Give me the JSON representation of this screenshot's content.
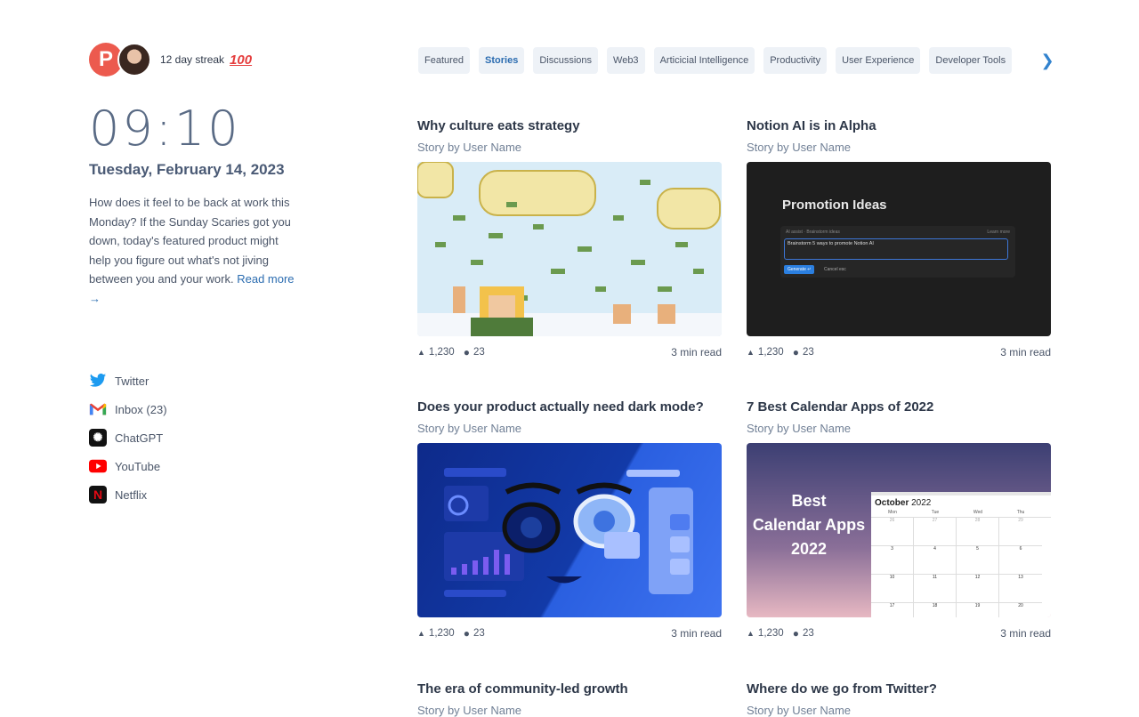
{
  "header": {
    "avatar_letter": "P",
    "streak": "12 day streak",
    "streak_emoji": "100"
  },
  "clock": {
    "time": "09:10",
    "date": "Tuesday, February 14, 2023"
  },
  "blurb": {
    "text": "How does it feel to be back at work this Monday? If the Sunday Scaries got you down, today's featured product might help you figure out what's not jiving between you and your work. ",
    "link": "Read more →"
  },
  "quick_links": [
    {
      "label": "Twitter",
      "icon": "twitter-icon"
    },
    {
      "label": "Inbox (23)",
      "icon": "gmail-icon"
    },
    {
      "label": "ChatGPT",
      "icon": "chatgpt-icon"
    },
    {
      "label": "YouTube",
      "icon": "youtube-icon"
    },
    {
      "label": "Netflix",
      "icon": "netflix-icon"
    }
  ],
  "tabs": [
    {
      "label": "Featured",
      "active": false
    },
    {
      "label": "Stories",
      "active": true
    },
    {
      "label": "Discussions",
      "active": false
    },
    {
      "label": "Web3",
      "active": false
    },
    {
      "label": "Articicial Intelligence",
      "active": false
    },
    {
      "label": "Productivity",
      "active": false
    },
    {
      "label": "User Experience",
      "active": false
    },
    {
      "label": "Developer Tools",
      "active": false
    }
  ],
  "cards": [
    {
      "title": "Why culture eats strategy",
      "byline": "Story by User Name",
      "upvotes": "1,230",
      "comments": "23",
      "read": "3 min read"
    },
    {
      "title": "Notion AI is in Alpha",
      "byline": "Story by User Name",
      "upvotes": "1,230",
      "comments": "23",
      "read": "3 min read",
      "image_text": {
        "heading": "Promotion Ideas",
        "ai_label": "AI assist · Brainstorm ideas",
        "learn": "Learn more",
        "prompt": "Brainstorm 5 ways to promote Notion AI",
        "generate": "Generate ↵",
        "cancel": "Cancel esc"
      }
    },
    {
      "title": "Does your product actually need dark mode?",
      "byline": "Story by User Name",
      "upvotes": "1,230",
      "comments": "23",
      "read": "3 min read"
    },
    {
      "title": "7 Best Calendar Apps of 2022",
      "byline": "Story by User Name",
      "upvotes": "1,230",
      "comments": "23",
      "read": "3 min read",
      "image_text": {
        "l1": "Best",
        "l2": "Calendar Apps",
        "l3": "2022",
        "month": "October",
        "year": "2022",
        "days": [
          "Mon",
          "Tue",
          "Wed",
          "Thu"
        ],
        "rows": [
          [
            "26",
            "27",
            "28",
            "29"
          ],
          [
            "3",
            "4",
            "5",
            "6"
          ],
          [
            "10",
            "11",
            "12",
            "13"
          ],
          [
            "17",
            "18",
            "19",
            "20"
          ]
        ]
      }
    },
    {
      "title": "The era of community-led growth",
      "byline": "Story by User Name"
    },
    {
      "title": "Where do we go from Twitter?",
      "byline": "Story by User Name"
    }
  ],
  "colors": {
    "accent": "#2b6cb0",
    "avatar": "#ec5a4e",
    "tab_bg": "#eef2f7"
  }
}
